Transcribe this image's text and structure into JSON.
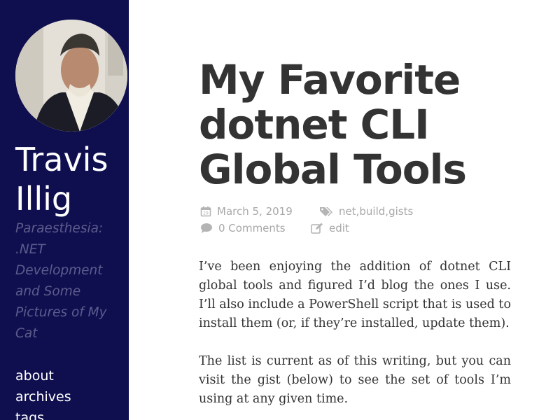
{
  "sidebar": {
    "site_title": "Travis Illig",
    "tagline": "Paraesthesia: .NET Development and Some Pictures of My Cat",
    "nav": [
      {
        "label": "about"
      },
      {
        "label": "archives"
      },
      {
        "label": "tags"
      }
    ]
  },
  "post": {
    "title": "My Favorite dotnet CLI Global Tools",
    "date": "March 5, 2019",
    "tags": [
      "net",
      "build",
      "gists"
    ],
    "tag_separator": ", ",
    "comments": "0 Comments",
    "edit_label": "edit",
    "paragraphs": [
      "I’ve been enjoying the addition of dotnet CLI global tools and figured I’d blog the ones I use. I’ll also include a PowerShell script that is used to install them (or, if they’re installed, update them).",
      "The list is current as of this writing, but you can visit the gist (below) to see the set of tools I’m using at any given time."
    ]
  },
  "icons": {
    "date": "calendar-icon",
    "tags": "tags-icon",
    "comments": "comment-icon",
    "edit": "edit-icon"
  },
  "colors": {
    "sidebar_bg": "#0f0f50",
    "tagline": "#5c5c8c",
    "title": "#333333",
    "meta": "#a8a8a8"
  }
}
